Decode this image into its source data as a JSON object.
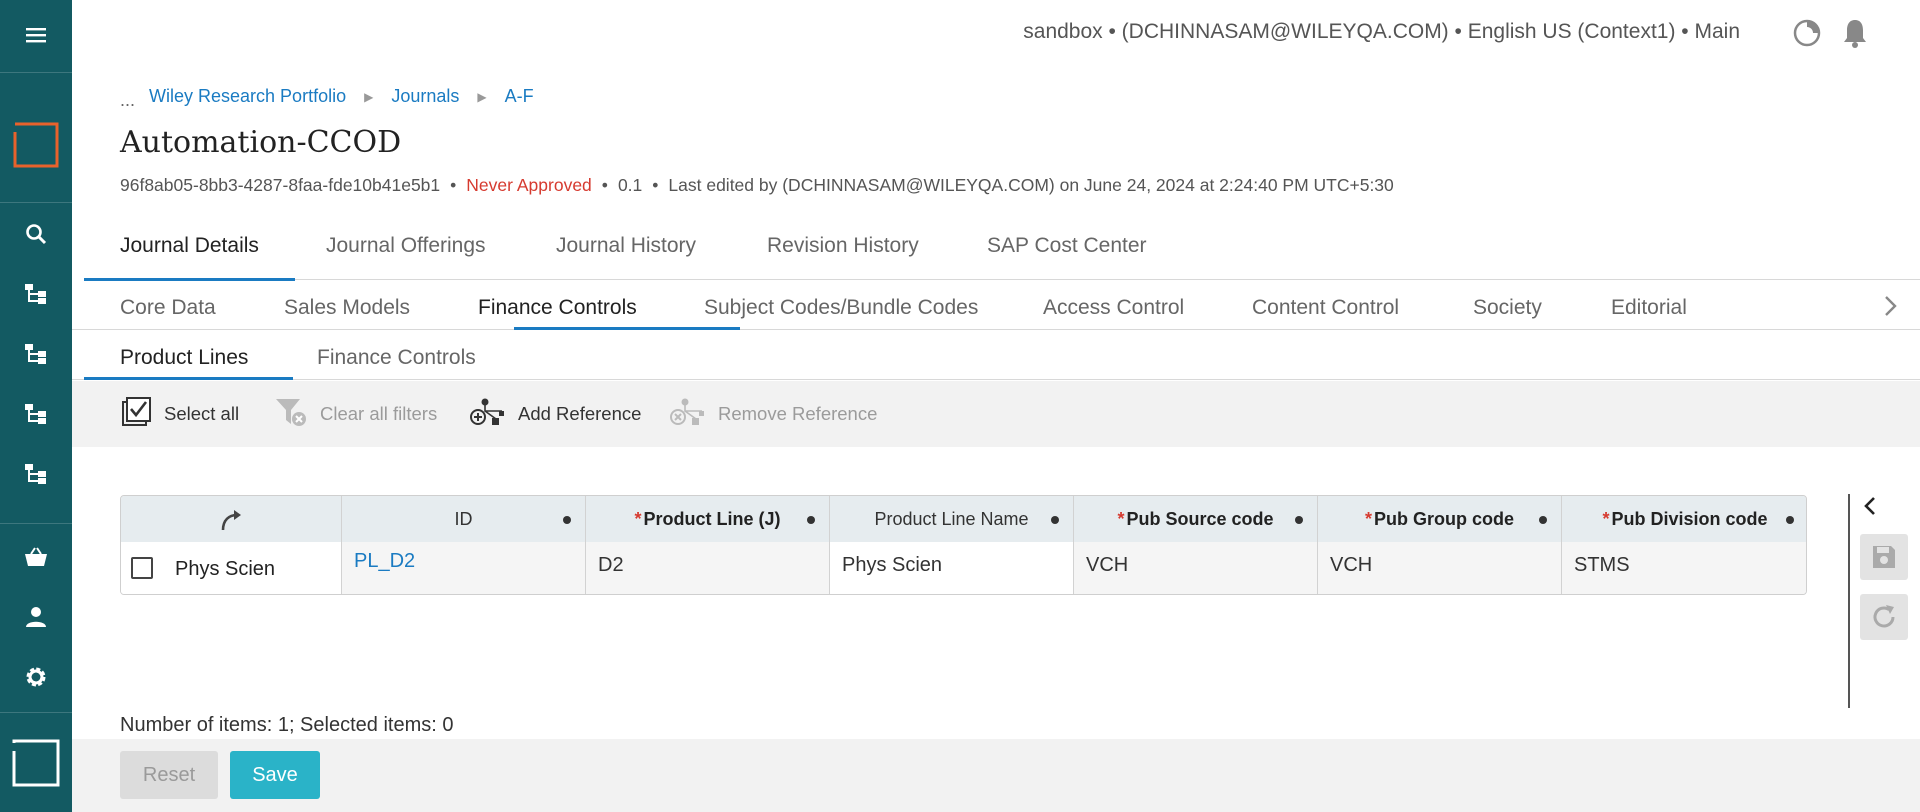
{
  "sidebar": {
    "items": [
      {
        "icon": "hamburger-menu-icon"
      },
      {
        "icon": "app-logo-icon"
      },
      {
        "icon": "search-icon"
      },
      {
        "icon": "hierarchy-icon"
      },
      {
        "icon": "hierarchy-icon"
      },
      {
        "icon": "hierarchy-icon"
      },
      {
        "icon": "hierarchy-icon"
      },
      {
        "icon": "basket-icon"
      },
      {
        "icon": "user-icon"
      },
      {
        "icon": "gear-icon"
      },
      {
        "icon": "square-logo-icon"
      }
    ],
    "background": "#135a62"
  },
  "header": {
    "context": "sandbox • (DCHINNASAM@WILEYQA.COM) • English US (Context1) • Main",
    "icons": [
      "refresh-moon-icon",
      "bell-icon"
    ]
  },
  "breadcrumb": {
    "ellipsis": "...",
    "items": [
      "Wiley Research Portfolio",
      "Journals",
      "A-F"
    ],
    "separator": "▶"
  },
  "page": {
    "title": "Automation-CCOD",
    "id": "96f8ab05-8bb3-4287-8faa-fde10b41e5b1",
    "status": "Never Approved",
    "version": "0.1",
    "last_edited": "Last edited by (DCHINNASAM@WILEYQA.COM) on June 24, 2024 at 2:24:40 PM UTC+5:30",
    "dot": "•"
  },
  "main_tabs": [
    "Journal Details",
    "Journal Offerings",
    "Journal History",
    "Revision History",
    "SAP Cost Center"
  ],
  "sub_tabs": [
    "Core Data",
    "Sales Models",
    "Finance Controls",
    "Subject Codes/Bundle Codes",
    "Access Control",
    "Content Control",
    "Society",
    "Editorial"
  ],
  "sub_sub_tabs": [
    "Product Lines",
    "Finance Controls"
  ],
  "toolbar": {
    "select_all": "Select all",
    "clear_filters": "Clear all filters",
    "add_reference": "Add Reference",
    "remove_reference": "Remove Reference"
  },
  "grid": {
    "columns": [
      {
        "label": "",
        "required": false
      },
      {
        "label": "ID",
        "required": false
      },
      {
        "label": "Product Line (J)",
        "required": true
      },
      {
        "label": "Product Line Name",
        "required": false
      },
      {
        "label": "Pub Source code",
        "required": true
      },
      {
        "label": "Pub Group code",
        "required": true
      },
      {
        "label": "Pub Division code",
        "required": true
      }
    ],
    "required_marker": "*",
    "rows": [
      {
        "label": "Phys Scien",
        "id": "PL_D2",
        "product_line": "D2",
        "product_line_name": "Phys Scien",
        "pub_source": "VCH",
        "pub_group": "VCH",
        "pub_division": "STMS"
      }
    ]
  },
  "status_bar": {
    "count_text": "Number of items: 1; Selected items: 0"
  },
  "footer": {
    "reset_label": "Reset",
    "save_label": "Save"
  },
  "colors": {
    "accent": "#1a7bc2",
    "status_red": "#d63a2f",
    "save_button": "#2ab3c8"
  }
}
